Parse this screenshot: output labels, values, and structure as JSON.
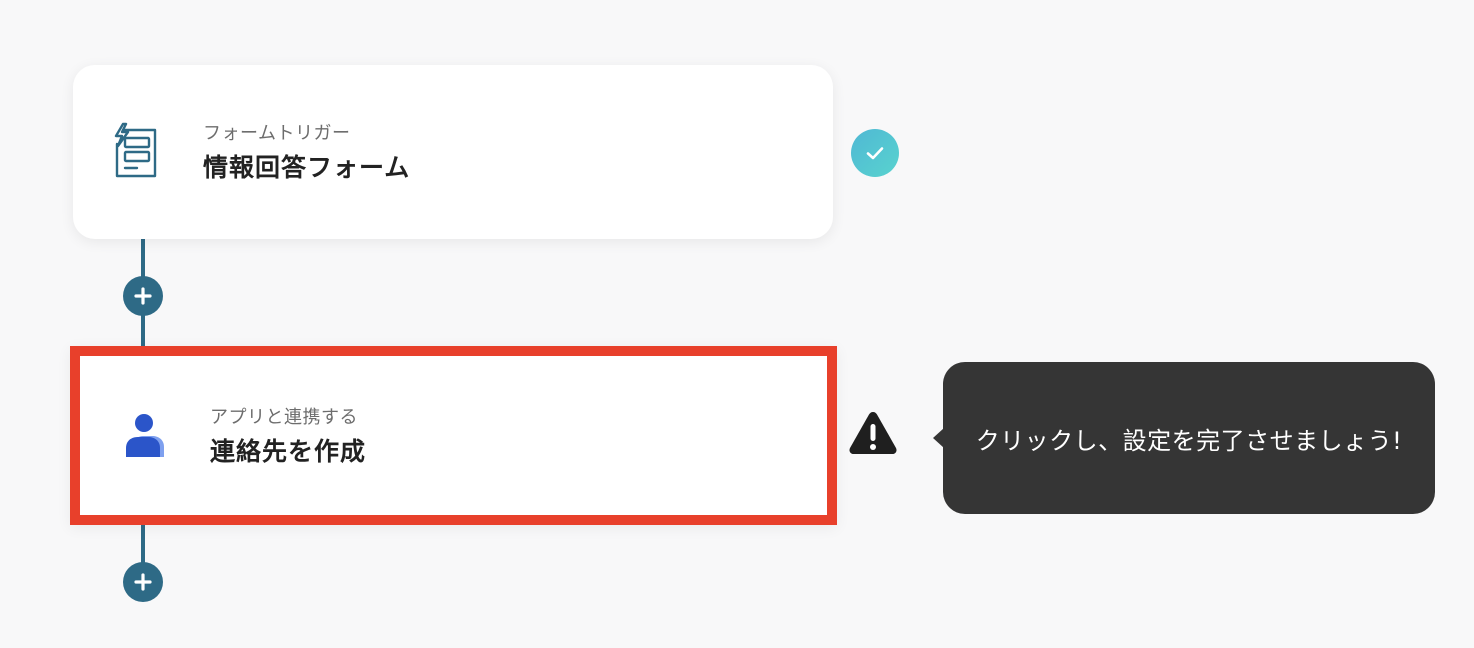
{
  "flow": {
    "trigger_step": {
      "subtitle": "フォームトリガー",
      "title": "情報回答フォーム",
      "icon": "form-trigger-icon",
      "status": "completed"
    },
    "action_step": {
      "subtitle": "アプリと連携する",
      "title": "連絡先を作成",
      "icon": "contact-person-icon",
      "status": "warning"
    },
    "add_step_buttons": [
      "+",
      "+"
    ]
  },
  "tooltip": {
    "text": "クリックし、設定を完了させましょう!"
  },
  "colors": {
    "accent": "#2e6a86",
    "highlight_border": "#e8402b",
    "check_gradient_start": "#4fb8d4",
    "check_gradient_end": "#59d3cf",
    "tooltip_bg": "#353535",
    "background": "#f8f8f9"
  }
}
